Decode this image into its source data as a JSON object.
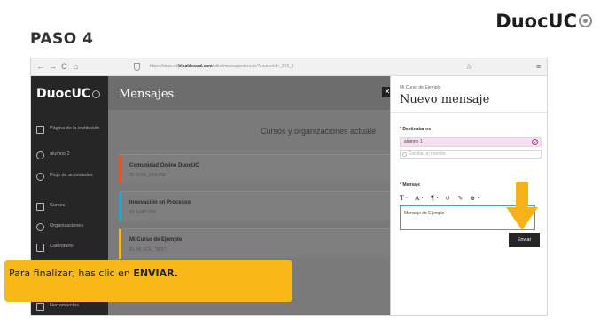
{
  "step_title": "PASO 4",
  "brand": {
    "name": "DuocUC"
  },
  "browser": {
    "nav": {
      "back": "←",
      "forward": "→",
      "reload": "C",
      "home": "⌂"
    },
    "url_prefix": "https://duoc.cl/",
    "url_domain": "blackboard.com",
    "url_path": "/ultra/messages/create?courseId=_365_1",
    "star": "☆",
    "menu": "≡"
  },
  "sidebar": {
    "logo": "DuocUC",
    "items": [
      {
        "label": "Página de la institución",
        "icon": "institution-icon"
      },
      {
        "label": "alumno 2",
        "icon": "user-icon"
      },
      {
        "label": "Flujo de actividades",
        "icon": "activity-icon"
      },
      {
        "label": "Cursos",
        "icon": "courses-icon"
      },
      {
        "label": "Organizaciones",
        "icon": "organizations-icon"
      },
      {
        "label": "Calendario",
        "icon": "calendar-icon"
      },
      {
        "label": "Herramientas",
        "icon": "tools-icon"
      }
    ]
  },
  "main": {
    "title": "Mensajes",
    "courses_heading": "Cursos y organizaciones actuale",
    "courses": [
      {
        "name": "Comunidad Online DuocUC",
        "id": "ID: COM_ONLINE",
        "color": "#e8542a"
      },
      {
        "name": "Innovación en Procesos",
        "id": "ID: EMP1206",
        "color": "#2fa3c4"
      },
      {
        "name": "Mi Curso de Ejemplo",
        "id": "ID: MI_FOL_TEST",
        "color": "#f0b92b"
      }
    ]
  },
  "panel": {
    "course_name": "Mi Curso de Ejemplo",
    "title": "Nuevo mensaje",
    "recipients_label": "Destinatarios",
    "recipient_chip": "alumno 1",
    "recipient_placeholder": "Escriba un nombre",
    "message_label": "Mensaje",
    "toolbar": [
      "T ·",
      "A ·",
      "¶ ·",
      "↺",
      "✎",
      "⊕ ·"
    ],
    "message_text": "Mensaje de Ejemplo",
    "send_label": "Enviar"
  },
  "callout": {
    "text_before": "Para finalizar, has clic en ",
    "emphasis": "ENVIAR."
  },
  "colors": {
    "accent": "#f8b818",
    "arrow": "#f6b219"
  }
}
